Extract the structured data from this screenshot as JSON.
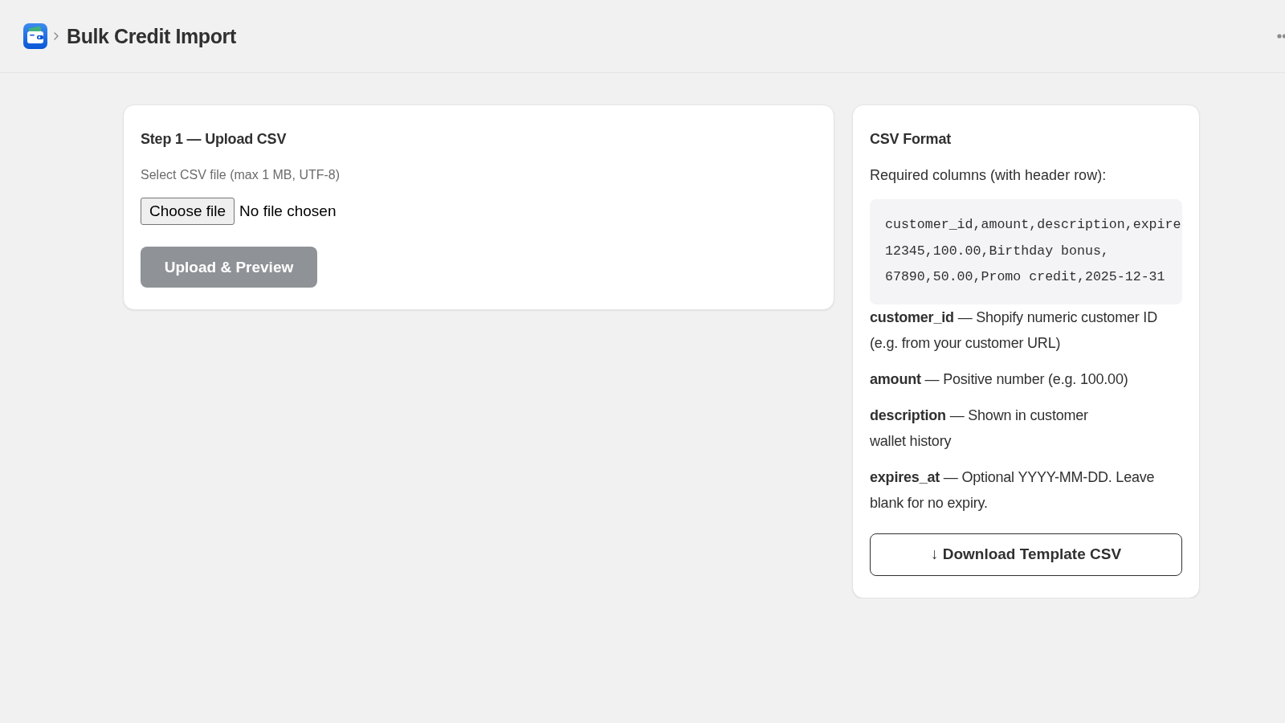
{
  "header": {
    "title": "Bulk Credit Import"
  },
  "upload_card": {
    "title": "Step 1 — Upload CSV",
    "file_label": "Select CSV file (max 1 MB, UTF-8)",
    "file_input": {
      "button_label": "Choose file",
      "status": "No file chosen"
    },
    "upload_button": {
      "label": "Upload & Preview",
      "disabled": true
    }
  },
  "format_card": {
    "title": "CSV Format",
    "intro": "Required columns (with header row):",
    "sample_lines": [
      "customer_id,amount,description,expire",
      "12345,100.00,Birthday bonus,",
      "67890,50.00,Promo credit,2025-12-31"
    ],
    "columns": [
      {
        "text": "**customer_id** — Shopify numeric customer ID (e.g. from your customer URL)"
      },
      {
        "text": "**amount** — Positive number (e.g. 100.00)"
      },
      {
        "text": "**description** — Shown in customer\nwallet history"
      },
      {
        "text": "**expires_at** — Optional YYYY-MM-DD. Leave blank for no expiry."
      }
    ],
    "download_button": {
      "label": "↓ Download Template CSV"
    }
  }
}
